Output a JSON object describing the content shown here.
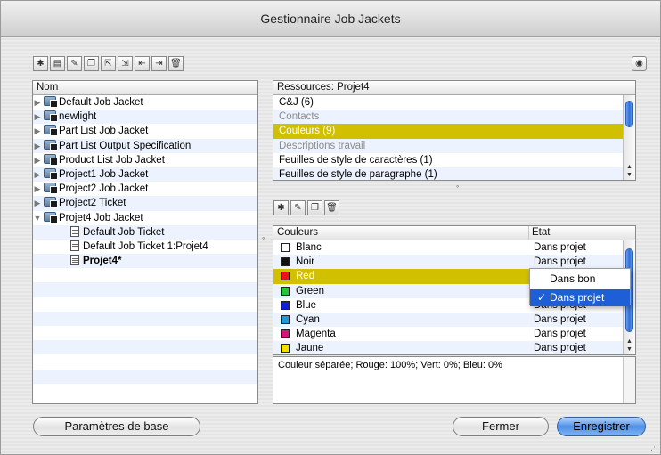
{
  "window": {
    "title": "Gestionnaire Job Jackets"
  },
  "toolbar_icons": [
    "new-job-jacket-icon",
    "new-ticket-icon",
    "edit-icon",
    "duplicate-icon",
    "open-icon",
    "close-file-icon",
    "import-icon",
    "export-icon",
    "delete-icon"
  ],
  "tree": {
    "header": "Nom",
    "items": [
      {
        "label": "Default Job Jacket",
        "level": 0,
        "expanded": false,
        "icon": "job-jacket-icon"
      },
      {
        "label": "newlight",
        "level": 0,
        "expanded": false,
        "icon": "job-jacket-icon"
      },
      {
        "label": "Part List Job Jacket",
        "level": 0,
        "expanded": false,
        "icon": "job-jacket-icon"
      },
      {
        "label": "Part List Output Specification",
        "level": 0,
        "expanded": false,
        "icon": "job-jacket-icon"
      },
      {
        "label": "Product List Job Jacket",
        "level": 0,
        "expanded": false,
        "icon": "job-jacket-icon"
      },
      {
        "label": "Project1 Job Jacket",
        "level": 0,
        "expanded": false,
        "icon": "job-jacket-icon"
      },
      {
        "label": "Project2 Job Jacket",
        "level": 0,
        "expanded": false,
        "icon": "job-jacket-icon"
      },
      {
        "label": "Project2 Ticket",
        "level": 0,
        "expanded": false,
        "icon": "job-jacket-icon"
      },
      {
        "label": "Projet4 Job Jacket",
        "level": 0,
        "expanded": true,
        "icon": "job-jacket-icon"
      },
      {
        "label": "Default Job Ticket",
        "level": 1,
        "icon": "ticket-icon"
      },
      {
        "label": "Default Job Ticket 1:Projet4",
        "level": 1,
        "icon": "ticket-icon"
      },
      {
        "label": "Projet4*",
        "level": 1,
        "icon": "project-icon",
        "bold": true
      }
    ]
  },
  "resources": {
    "header": "Ressources: Projet4",
    "items": [
      {
        "label": "C&J (6)",
        "state": "normal"
      },
      {
        "label": "Contacts",
        "state": "dim"
      },
      {
        "label": "Couleurs (9)",
        "state": "selected"
      },
      {
        "label": "Descriptions travail",
        "state": "dim"
      },
      {
        "label": "Feuilles de style de caractères (1)",
        "state": "normal"
      },
      {
        "label": "Feuilles de style de paragraphe (1)",
        "state": "normal"
      }
    ]
  },
  "sub_toolbar_icons": [
    "new-icon",
    "edit-icon",
    "duplicate-icon",
    "delete-icon"
  ],
  "colors_table": {
    "col_name": "Couleurs",
    "col_state": "Etat",
    "rows": [
      {
        "name": "Blanc",
        "swatch": "#ffffff",
        "state": "Dans projet"
      },
      {
        "name": "Noir",
        "swatch": "#111111",
        "state": "Dans projet"
      },
      {
        "name": "Red",
        "swatch": "#e8141c",
        "state": "Dans projet",
        "selected": true
      },
      {
        "name": "Green",
        "swatch": "#25c43a",
        "state": "Dans projet"
      },
      {
        "name": "Blue",
        "swatch": "#1020d8",
        "state": "Dans projet"
      },
      {
        "name": "Cyan",
        "swatch": "#1e9bd7",
        "state": "Dans projet"
      },
      {
        "name": "Magenta",
        "swatch": "#d6157a",
        "state": "Dans projet"
      },
      {
        "name": "Jaune",
        "swatch": "#f1e100",
        "state": "Dans projet"
      }
    ]
  },
  "popup": {
    "options": [
      "Dans bon",
      "Dans projet"
    ],
    "selected": "Dans projet",
    "checkmark": "✓"
  },
  "description": "Couleur séparée; Rouge: 100%; Vert: 0%; Bleu: 0%",
  "buttons": {
    "base_settings": "Paramètres de base",
    "close": "Fermer",
    "save": "Enregistrer"
  }
}
